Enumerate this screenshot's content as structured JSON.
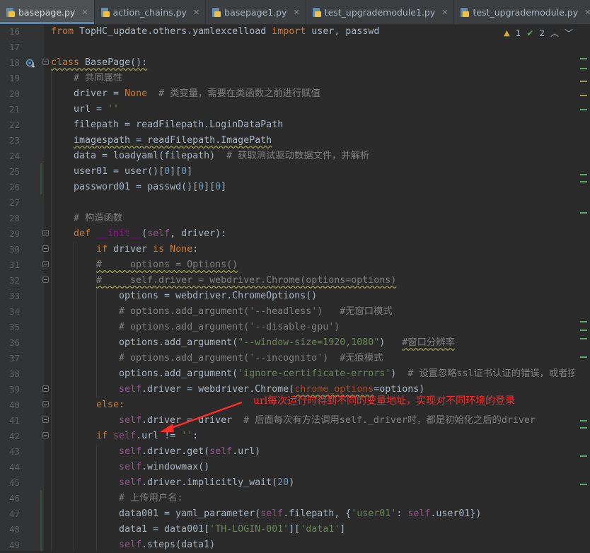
{
  "tabs": [
    {
      "label": "basepage.py",
      "active": true
    },
    {
      "label": "action_chains.py",
      "active": false
    },
    {
      "label": "basepage1.py",
      "active": false
    },
    {
      "label": "test_upgrademodule1.py",
      "active": false
    },
    {
      "label": "test_upgrademodule.py",
      "active": false
    }
  ],
  "inspection": {
    "warnings": "1",
    "weak_warnings": "2"
  },
  "line_numbers": [
    "16",
    "17",
    "18",
    "19",
    "20",
    "21",
    "22",
    "23",
    "24",
    "25",
    "26",
    "27",
    "28",
    "29",
    "30",
    "31",
    "32",
    "33",
    "34",
    "35",
    "36",
    "37",
    "38",
    "39",
    "40",
    "41",
    "42",
    "43",
    "44",
    "45",
    "46",
    "47",
    "48",
    "49"
  ],
  "code_text": {
    "l16a": "from ",
    "l16b": "TopHC_update.others.yamlexcelload ",
    "l16c": "import ",
    "l16d": "user, passwd",
    "l18a": "class ",
    "l18b": "BasePage():",
    "l19": "# 共同属性",
    "l20a": "driver = ",
    "l20b": "None",
    "l20c": "  # 类变量，需要在类函数之前进行赋值",
    "l21a": "url = ",
    "l21b": "''",
    "l22": "filepath = readFilepath.LoginDataPath",
    "l23": "imagespath = readFilepath.ImagePath",
    "l24a": "data = loadyaml(filepath)",
    "l24b": "  # 获取测试驱动数据文件，并解析",
    "l25a": "user01 = user()[",
    "l25b": "0",
    "l25c": "][",
    "l25d": "0",
    "l25e": "]",
    "l26a": "password01 = passwd()[",
    "l26b": "0",
    "l26c": "][",
    "l26d": "0",
    "l26e": "]",
    "l28": "# 构造函数",
    "l29a": "def ",
    "l29b": "__init__",
    "l29c": "(",
    "l29d": "self",
    "l29e": ", driver):",
    "l30a": "if ",
    "l30b": "driver ",
    "l30c": "is None",
    "l30d": ":",
    "l31": "#     options = Options()",
    "l32": "#     self.driver = webdriver.Chrome(options=options)",
    "l33": "options = webdriver.ChromeOptions()",
    "l34": "# options.add_argument('--headless')   #无窗口模式",
    "l35": "# options.add_argument('--disable-gpu')",
    "l36a": "options.add_argument(",
    "l36b": "\"--window-size=1920,1080\"",
    "l36c": ")   ",
    "l36d": "#窗口分辨率",
    "l37": "# options.add_argument('--incognito')  #无痕模式",
    "l38a": "options.add_argument(",
    "l38b": "'ignore-certificate-errors'",
    "l38c": ")  ",
    "l38d": "# 设置忽略ssl证书认证的错误，或者接收不",
    "l39a": "self",
    "l39b": ".driver = webdriver.Chrome(",
    "l39c": "chrome_options",
    "l39d": "=options)",
    "l40": "else:",
    "l41a": "self",
    "l41b": ".driver = driver",
    "l41c": "  # 后面每次有方法调用self._driver时，都是初始化之后的driver",
    "l42a": "if ",
    "l42b": "self",
    "l42c": ".url != ",
    "l42d": "''",
    "l42e": ":",
    "l43a": "self",
    "l43b": ".driver.get(",
    "l43c": "self",
    "l43d": ".url)",
    "l44a": "self",
    "l44b": ".windowmax()",
    "l45a": "self",
    "l45b": ".driver.implicitly_wait(",
    "l45c": "20",
    "l45d": ")",
    "l46": "# 上传用户名:",
    "l47a": "data001 = yaml_parameter(",
    "l47b": "self",
    "l47c": ".filepath, {",
    "l47d": "'user01'",
    "l47e": ": ",
    "l47f": "self",
    "l47g": ".user01})",
    "l48a": "data1 = data001[",
    "l48b": "'TH-LOGIN-001'",
    "l48c": "][",
    "l48d": "'data1'",
    "l48e": "]",
    "l49a": "self",
    "l49b": ".steps(data1)"
  },
  "annotation": "url每次运行时得到不同的变量地址，实现对不同环境的登录",
  "colors": {
    "background": "#2b2b2b",
    "annotation": "#ff2a2a",
    "keyword": "#cc7832",
    "string": "#6a8759",
    "comment": "#808080",
    "self": "#94558d"
  }
}
